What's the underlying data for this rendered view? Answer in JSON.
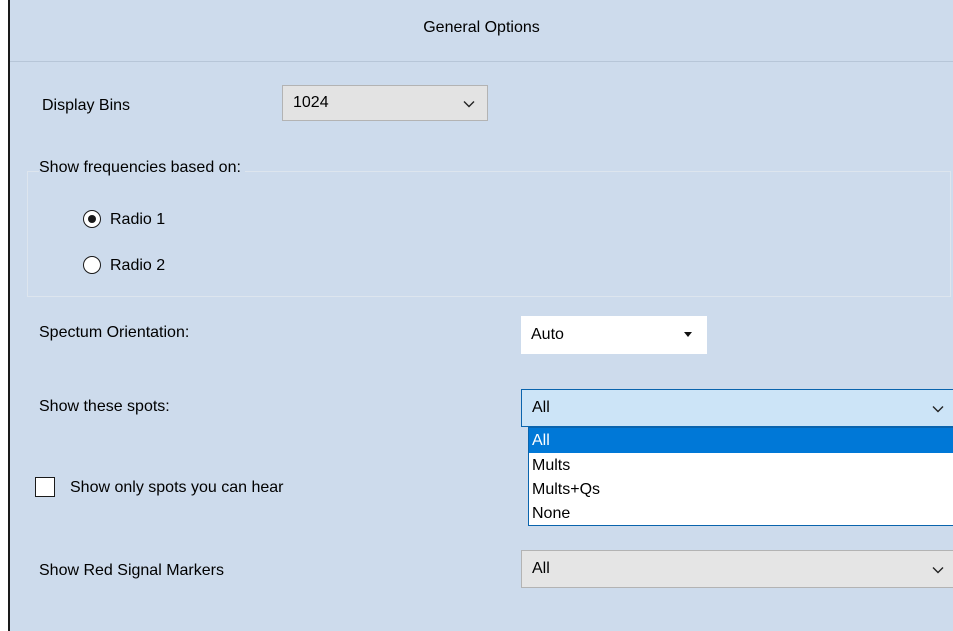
{
  "window": {
    "title": "General Options"
  },
  "display_bins": {
    "label": "Display Bins",
    "value": "1024",
    "icon": "chevron-down-icon"
  },
  "frequencies": {
    "label": "Show frequencies based on:",
    "options": [
      {
        "label": "Radio 1",
        "selected": true
      },
      {
        "label": "Radio 2",
        "selected": false
      }
    ]
  },
  "orientation": {
    "label": "Spectum Orientation:",
    "value": "Auto",
    "icon": "triangle-down-icon"
  },
  "spots": {
    "label": "Show these spots:",
    "value": "All",
    "icon": "chevron-down-icon",
    "options": [
      "All",
      "Mults",
      "Mults+Qs",
      "None"
    ],
    "selected_index": 0
  },
  "hear_only": {
    "label": "Show only spots you can hear",
    "checked": false
  },
  "red_markers": {
    "label": "Show Red Signal Markers",
    "value": "All",
    "icon": "chevron-down-icon"
  },
  "colors": {
    "panel_bg": "#cddbec",
    "selection": "#0078d7",
    "focus_border": "#0a64ad"
  }
}
